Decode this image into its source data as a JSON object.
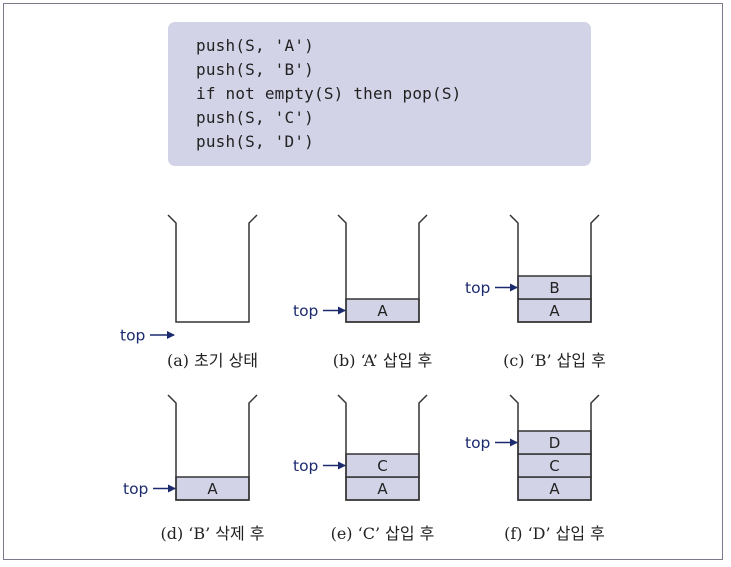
{
  "code": [
    "push(S, 'A')",
    "push(S, 'B')",
    "if not empty(S) then pop(S)",
    "push(S, 'C')",
    "push(S, 'D')"
  ],
  "top_label": "top",
  "colors": {
    "frame": "#7a7a8c",
    "code_background": "#d3d3e8",
    "cell_fill": "#d3d3e8",
    "stack_line": "#333333",
    "top_label": "#1c2a6e",
    "text": "#222222"
  },
  "stacks": [
    {
      "id": "a",
      "caption": "(a) 초기 상태",
      "cells": []
    },
    {
      "id": "b",
      "caption": "(b) ‘A’ 삽입 후",
      "cells": [
        "A"
      ]
    },
    {
      "id": "c",
      "caption": "(c) ‘B’ 삽입 후",
      "cells": [
        "A",
        "B"
      ]
    },
    {
      "id": "d",
      "caption": "(d) ‘B’ 삭제 후",
      "cells": [
        "A"
      ]
    },
    {
      "id": "e",
      "caption": "(e) ‘C’ 삽입 후",
      "cells": [
        "A",
        "C"
      ]
    },
    {
      "id": "f",
      "caption": "(f) ‘D’ 삽입 후",
      "cells": [
        "A",
        "C",
        "D"
      ]
    }
  ]
}
